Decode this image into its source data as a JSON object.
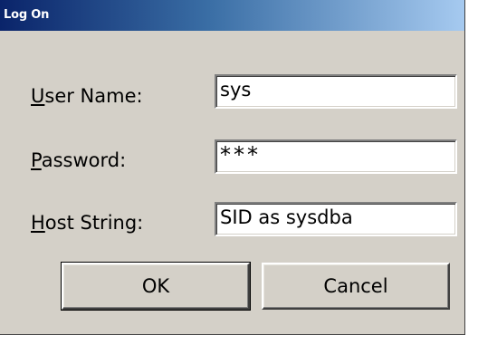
{
  "window": {
    "title": "Log On"
  },
  "form": {
    "user_name": {
      "label_mnemonic": "U",
      "label_rest": "ser Name:",
      "value": "sys"
    },
    "password": {
      "label_mnemonic": "P",
      "label_rest": "assword:",
      "value": "***"
    },
    "host_string": {
      "label_mnemonic": "H",
      "label_rest": "ost String:",
      "value": "SID as sysdba"
    }
  },
  "buttons": {
    "ok_label": "OK",
    "cancel_label": "Cancel"
  },
  "colors": {
    "dialog_bg": "#d4d0c8",
    "title_start": "#0a246a",
    "title_end": "#a6caf0"
  }
}
